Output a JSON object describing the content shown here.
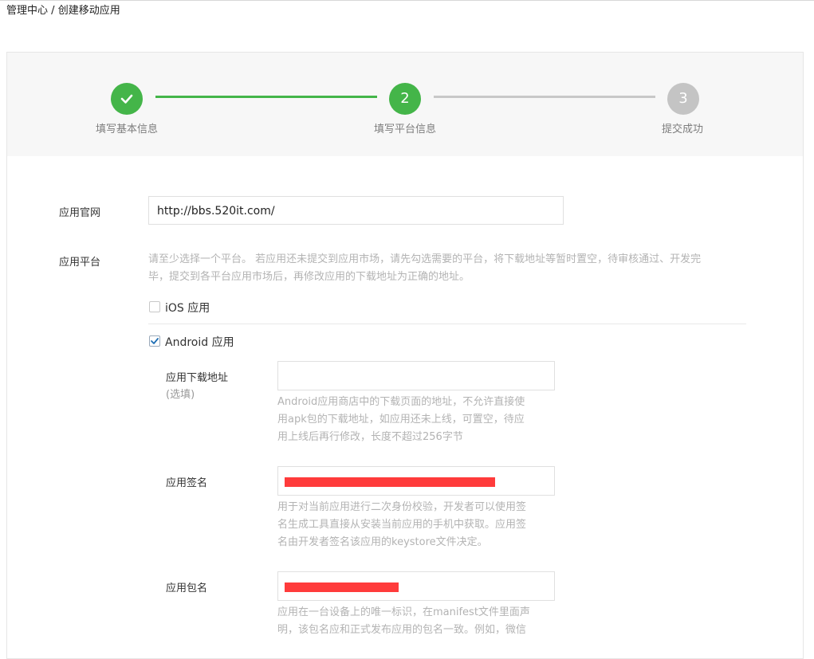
{
  "breadcrumb": {
    "root": "管理中心",
    "separator": "/",
    "current": "创建移动应用"
  },
  "steps": [
    {
      "number": "",
      "label": "填写基本信息",
      "state": "done"
    },
    {
      "number": "2",
      "label": "填写平台信息",
      "state": "active"
    },
    {
      "number": "3",
      "label": "提交成功",
      "state": "pending"
    }
  ],
  "colors": {
    "accent": "#44b549",
    "pending": "#c4c4c4",
    "redaction": "#ff3b3b"
  },
  "form": {
    "website": {
      "label": "应用官网",
      "value": "http://bbs.520it.com/"
    },
    "platform": {
      "label": "应用平台",
      "description": [
        "请至少选择一个平台。 若应用还未提交到应用市场，请先勾选需要的平台，将下载地址等暂时置空，待审核通过、开发完",
        "毕，提交到各平台应用市场后，再修改应用的下载地址为正确的地址。"
      ],
      "ios": {
        "label": "iOS 应用",
        "checked": false
      },
      "android": {
        "label": "Android 应用",
        "checked": true,
        "download": {
          "label": "应用下载地址",
          "optional": "(选填)",
          "value": "",
          "description": [
            "Android应用商店中的下载页面的地址，不允许直接使",
            "用apk包的下载地址，如应用还未上线，可置空，待应",
            "用上线后再行修改，长度不超过256字节"
          ]
        },
        "signature": {
          "label": "应用签名",
          "description": [
            "用于对当前应用进行二次身份校验，开发者可以使用签",
            "名生成工具直接从安装当前应用的手机中获取。应用签",
            "名由开发者签名该应用的keystore文件决定。"
          ]
        },
        "package": {
          "label": "应用包名",
          "description": [
            "应用在一台设备上的唯一标识，在manifest文件里面声",
            "明，该包名应和正式发布应用的包名一致。例如，微信"
          ]
        }
      }
    }
  }
}
